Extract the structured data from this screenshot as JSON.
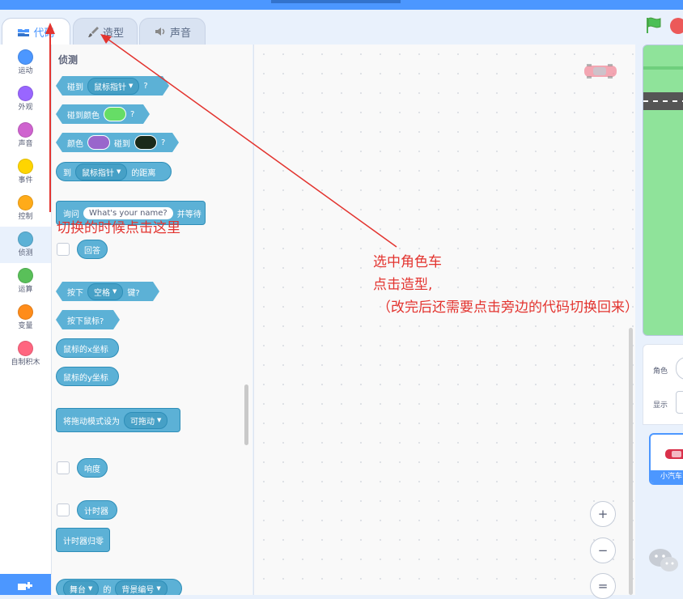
{
  "tabs": [
    {
      "label": "代码",
      "icon": "code-blocks-icon"
    },
    {
      "label": "造型",
      "icon": "paintbrush-icon"
    },
    {
      "label": "声音",
      "icon": "speaker-icon"
    }
  ],
  "categories": [
    {
      "label": "运动",
      "color": "#4c97ff"
    },
    {
      "label": "外观",
      "color": "#9966ff"
    },
    {
      "label": "声音",
      "color": "#cf63cf"
    },
    {
      "label": "事件",
      "color": "#ffd500"
    },
    {
      "label": "控制",
      "color": "#ffab19"
    },
    {
      "label": "侦测",
      "color": "#5cb1d6"
    },
    {
      "label": "运算",
      "color": "#59c059"
    },
    {
      "label": "变量",
      "color": "#ff8c1a"
    },
    {
      "label": "自制积木",
      "color": "#ff6680"
    }
  ],
  "palette": {
    "title": "侦测",
    "blocks": {
      "touching": {
        "text": "碰到",
        "dropdown": "鼠标指针",
        "suffix": "?"
      },
      "touching_color": {
        "text": "碰到颜色",
        "suffix": "?",
        "color": "#66dd66"
      },
      "color_touching": {
        "text1": "颜色",
        "text2": "碰到",
        "suffix": "?",
        "color1": "#9966cc",
        "color2": "#1a2a1a"
      },
      "distance": {
        "text1": "到",
        "dropdown": "鼠标指针",
        "text2": "的距离"
      },
      "ask": {
        "text1": "询问",
        "input": "What's your name?",
        "text2": "并等待"
      },
      "answer": {
        "text": "回答"
      },
      "key_pressed": {
        "text1": "按下",
        "dropdown": "空格",
        "text2": "键?"
      },
      "mouse_down": {
        "text": "按下鼠标?"
      },
      "mouse_x": {
        "text": "鼠标的x坐标"
      },
      "mouse_y": {
        "text": "鼠标的y坐标"
      },
      "drag_mode": {
        "text": "将拖动模式设为",
        "dropdown": "可拖动"
      },
      "loudness": {
        "text": "响度"
      },
      "timer": {
        "text": "计时器"
      },
      "reset_timer": {
        "text": "计时器归零"
      },
      "of": {
        "dropdown1": "舞台",
        "text": "的",
        "dropdown2": "背景编号"
      }
    }
  },
  "zoom": {
    "in": "+",
    "out": "−",
    "reset": "="
  },
  "sprite_info": {
    "sprite_label": "角色",
    "show_label": "显示"
  },
  "sprite_card": {
    "name": "小汽车"
  },
  "annotations": {
    "left": "切换的时候点击这里",
    "right_line1": "选中角色车",
    "right_line2": "点击造型,",
    "right_line3": "（改完后还需要点击旁边的代码切换回来）"
  },
  "colors": {
    "accent": "#4c97ff",
    "sensing": "#5cb1d6",
    "annotation": "#e3342f"
  }
}
